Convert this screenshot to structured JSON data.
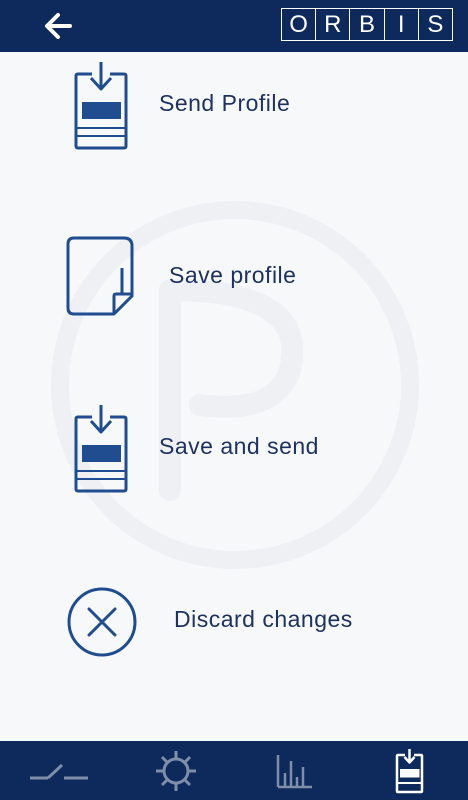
{
  "header": {
    "back_icon": "arrow-left-icon",
    "logo_letters": [
      "O",
      "R",
      "B",
      "I",
      "S"
    ]
  },
  "menu": {
    "items": [
      {
        "label": "Send Profile",
        "icon": "send-profile-icon"
      },
      {
        "label": "Save profile",
        "icon": "save-profile-icon"
      },
      {
        "label": "Save and send",
        "icon": "save-and-send-icon"
      },
      {
        "label": "Discard changes",
        "icon": "discard-icon"
      }
    ]
  },
  "bottom_nav": {
    "items": [
      {
        "icon": "switch-icon",
        "active": false
      },
      {
        "icon": "gear-icon",
        "active": false
      },
      {
        "icon": "chart-icon",
        "active": false
      },
      {
        "icon": "send-profile-icon",
        "active": true
      }
    ]
  },
  "colors": {
    "primary": "#0e2a5c",
    "text": "#1d3260",
    "icon": "#1f4d8f",
    "inactive_nav": "#7f8ea8",
    "background": "#f7f8fa"
  }
}
